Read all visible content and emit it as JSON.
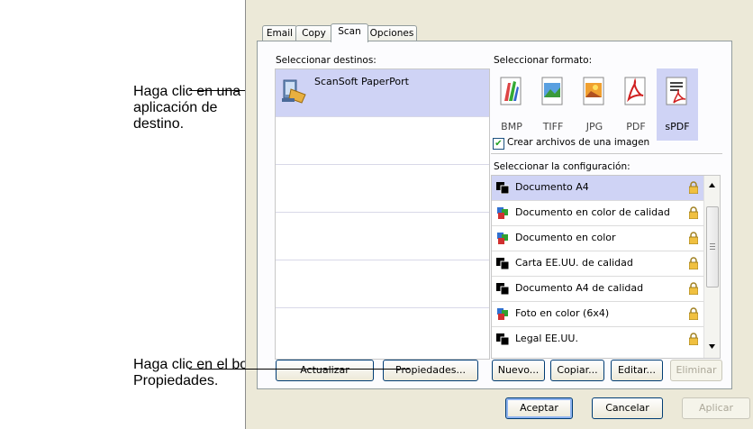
{
  "callouts": {
    "dest_text": "Haga clic en una aplicación de destino.",
    "props_text": "Haga clic en el botón Propiedades."
  },
  "tabs": [
    {
      "label": "Email",
      "active": false
    },
    {
      "label": "Copy",
      "active": false
    },
    {
      "label": "Scan",
      "active": true
    },
    {
      "label": "Opciones",
      "active": false
    }
  ],
  "destinations": {
    "label": "Seleccionar destinos:",
    "items": [
      {
        "name": "ScanSoft PaperPort",
        "icon": "paperport-icon",
        "selected": true
      }
    ]
  },
  "format": {
    "label": "Seleccionar formato:",
    "items": [
      {
        "label": "BMP",
        "icon": "bmp-icon",
        "selected": false
      },
      {
        "label": "TIFF",
        "icon": "tiff-icon",
        "selected": false
      },
      {
        "label": "JPG",
        "icon": "jpg-icon",
        "selected": false
      },
      {
        "label": "PDF",
        "icon": "pdf-icon",
        "selected": false
      },
      {
        "label": "sPDF",
        "icon": "spdf-icon",
        "selected": true
      }
    ],
    "single_image_checkbox": {
      "label": "Crear archivos de una imagen",
      "checked": true
    }
  },
  "configuration": {
    "label": "Seleccionar la configuración:",
    "items": [
      {
        "name": "Documento A4",
        "icon": "bw-document-icon",
        "selected": true
      },
      {
        "name": "Documento en color de calidad",
        "icon": "color-document-icon",
        "selected": false
      },
      {
        "name": "Documento en color",
        "icon": "color-document-icon",
        "selected": false
      },
      {
        "name": "Carta EE.UU. de calidad",
        "icon": "bw-document-icon",
        "selected": false
      },
      {
        "name": "Documento A4 de calidad",
        "icon": "bw-document-icon",
        "selected": false
      },
      {
        "name": "Foto en color (6x4)",
        "icon": "color-document-icon",
        "selected": false
      },
      {
        "name": "Legal EE.UU.",
        "icon": "bw-document-icon",
        "selected": false
      }
    ]
  },
  "buttons": {
    "update": "Actualizar",
    "properties": "Propiedades...",
    "new": "Nuevo...",
    "copy": "Copiar...",
    "edit": "Editar...",
    "delete": "Eliminar",
    "accept": "Aceptar",
    "cancel": "Cancelar",
    "apply": "Aplicar"
  },
  "colors": {
    "selection": "#cfd3f5",
    "dialog_bg": "#ece9d8",
    "panel_bg": "#fcfcfe"
  }
}
